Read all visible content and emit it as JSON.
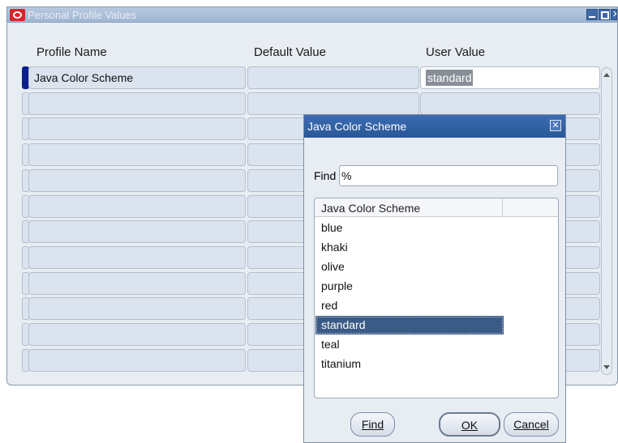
{
  "window": {
    "title": "Personal Profile Values"
  },
  "table": {
    "headers": {
      "profile_name": "Profile Name",
      "default_value": "Default Value",
      "user_value": "User Value"
    },
    "rows": [
      {
        "profile_name": "Java Color Scheme",
        "default_value": "",
        "user_value": "standard"
      },
      {
        "profile_name": "",
        "default_value": "",
        "user_value": ""
      },
      {
        "profile_name": "",
        "default_value": "",
        "user_value": ""
      },
      {
        "profile_name": "",
        "default_value": "",
        "user_value": ""
      },
      {
        "profile_name": "",
        "default_value": "",
        "user_value": ""
      },
      {
        "profile_name": "",
        "default_value": "",
        "user_value": ""
      },
      {
        "profile_name": "",
        "default_value": "",
        "user_value": ""
      },
      {
        "profile_name": "",
        "default_value": "",
        "user_value": ""
      },
      {
        "profile_name": "",
        "default_value": "",
        "user_value": ""
      },
      {
        "profile_name": "",
        "default_value": "",
        "user_value": ""
      },
      {
        "profile_name": "",
        "default_value": "",
        "user_value": ""
      },
      {
        "profile_name": "",
        "default_value": "",
        "user_value": ""
      }
    ]
  },
  "dialog": {
    "title": "Java Color Scheme",
    "find_label": "Find",
    "find_value": "%",
    "list_header": "Java Color Scheme",
    "items": [
      "blue",
      "khaki",
      "olive",
      "purple",
      "red",
      "standard",
      "teal",
      "titanium"
    ],
    "selected": "standard",
    "buttons": {
      "find": "Find",
      "ok": "OK",
      "cancel": "Cancel"
    }
  },
  "colors": {
    "title_active": "#285896",
    "selection": "#3a5b85",
    "row_marker": "#0b1f8e"
  }
}
